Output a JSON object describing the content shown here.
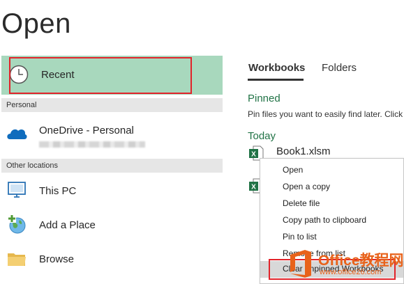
{
  "page": {
    "title": "Open"
  },
  "left_nav": {
    "recent_label": "Recent",
    "personal_header": "Personal",
    "onedrive_label": "OneDrive - Personal",
    "other_locations_header": "Other locations",
    "this_pc_label": "This PC",
    "add_place_label": "Add a Place",
    "browse_label": "Browse"
  },
  "tabs": {
    "workbooks": "Workbooks",
    "folders": "Folders"
  },
  "pinned": {
    "heading": "Pinned",
    "hint": "Pin files you want to easily find later. Click"
  },
  "today": {
    "heading": "Today",
    "files": [
      "Book1.xlsm"
    ]
  },
  "context_menu": {
    "items": [
      "Open",
      "Open a copy",
      "Delete file",
      "Copy path to clipboard",
      "Pin to list",
      "Remove from list",
      "Clear unpinned Workbooks"
    ],
    "highlighted_item": "Clear unpinned Workbooks"
  },
  "watermark": {
    "line1": "Office教程网",
    "line2": "www.office26.com"
  },
  "colors": {
    "recent_bg": "#a8d8bd",
    "accent_green": "#217346",
    "annotation_red": "#e2232a",
    "watermark_orange": "#e8621a"
  },
  "icons": [
    "clock-icon",
    "onedrive-icon",
    "this-pc-icon",
    "add-place-icon",
    "folder-icon",
    "excel-file-icon",
    "office-logo-icon"
  ]
}
